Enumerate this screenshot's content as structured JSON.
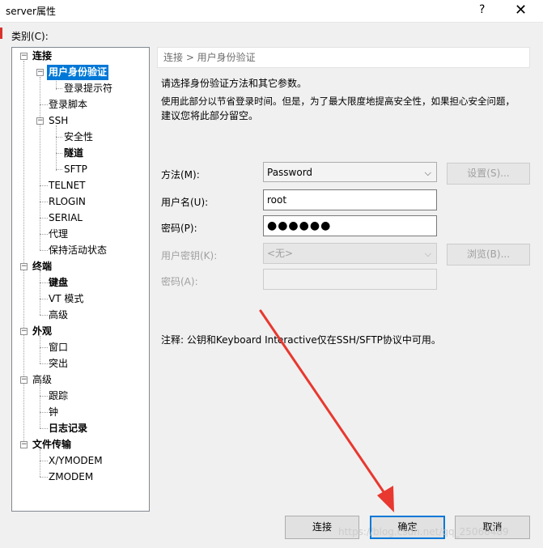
{
  "window": {
    "title": "server属性",
    "help": "?",
    "close": "✕"
  },
  "category_label": "类别(C):",
  "tree": [
    {
      "label": "连接",
      "bold": true
    },
    {
      "label": "用户身份验证",
      "bold": true,
      "selected": true
    },
    {
      "label": "登录提示符"
    },
    {
      "label": "登录脚本"
    },
    {
      "label": "SSH"
    },
    {
      "label": "安全性"
    },
    {
      "label": "隧道",
      "bold": true
    },
    {
      "label": "SFTP"
    },
    {
      "label": "TELNET"
    },
    {
      "label": "RLOGIN"
    },
    {
      "label": "SERIAL"
    },
    {
      "label": "代理"
    },
    {
      "label": "保持活动状态"
    },
    {
      "label": "终端",
      "bold": true
    },
    {
      "label": "键盘",
      "bold": true
    },
    {
      "label": "VT 模式"
    },
    {
      "label": "高级"
    },
    {
      "label": "外观",
      "bold": true
    },
    {
      "label": "窗口"
    },
    {
      "label": "突出"
    },
    {
      "label": "高级"
    },
    {
      "label": "跟踪"
    },
    {
      "label": "钟"
    },
    {
      "label": "日志记录",
      "bold": true
    },
    {
      "label": "文件传输",
      "bold": true
    },
    {
      "label": "X/YMODEM"
    },
    {
      "label": "ZMODEM"
    }
  ],
  "breadcrumb": "连接 > 用户身份验证",
  "description": {
    "line1": "请选择身份验证方法和其它参数。",
    "line2": "使用此部分以节省登录时间。但是，为了最大限度地提高安全性，如果担心安全问题，",
    "line3": "建议您将此部分留空。"
  },
  "form": {
    "method_label": "方法(M):",
    "method_value": "Password",
    "settings_button": "设置(S)...",
    "username_label": "用户名(U):",
    "username_value": "root",
    "password_label": "密码(P):",
    "password_value": "●●●●●●",
    "userkey_label": "用户密钥(K):",
    "userkey_value": "<无>",
    "browse_button": "浏览(B)...",
    "passphrase_label": "密码(A):",
    "passphrase_value": ""
  },
  "note": "注释: 公钥和Keyboard Interactive仅在SSH/SFTP协议中可用。",
  "buttons": {
    "connect": "连接",
    "ok": "确定",
    "cancel": "取消"
  },
  "watermark": "https://blog.csdn.net/qq_25060489",
  "colors": {
    "selection": "#0078d7",
    "arrow": "#e8382f"
  }
}
